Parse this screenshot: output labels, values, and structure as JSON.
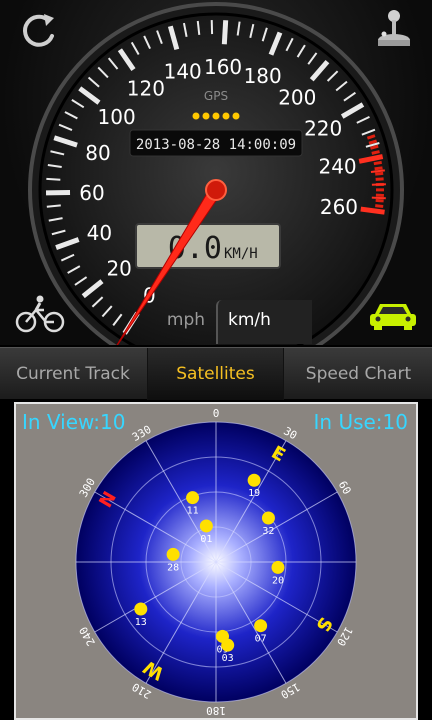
{
  "speedometer": {
    "gps_label": "GPS",
    "datetime": "2013-08-28 14:00:09",
    "speed": "0.0",
    "speed_unit": "KM/H",
    "speed_value": 0,
    "max_speed": 260,
    "gps_signal_dots": 5,
    "ticks": [
      "0",
      "20",
      "40",
      "60",
      "80",
      "100",
      "120",
      "140",
      "160",
      "180",
      "200",
      "220",
      "240",
      "260"
    ]
  },
  "unit_toggle": {
    "mph": "mph",
    "kmh": "km/h",
    "selected": "km/h"
  },
  "icons": {
    "refresh": "refresh-icon",
    "joystick": "joystick-icon",
    "bike": "bicycle-icon",
    "car": "car-icon"
  },
  "tabs": [
    {
      "label": "Current Track",
      "active": false
    },
    {
      "label": "Satellites",
      "active": true
    },
    {
      "label": "Speed Chart",
      "active": false
    }
  ],
  "satellites": {
    "in_view": "In View:10",
    "in_use": "In Use:10",
    "compass": {
      "N": "N",
      "E": "E",
      "S": "S",
      "W": "W"
    },
    "azimuth_labels": [
      "0",
      "30",
      "60",
      "120",
      "150",
      "180",
      "210",
      "240",
      "300",
      "330"
    ],
    "list": [
      {
        "prn": "19",
        "az": 25,
        "el": 32
      },
      {
        "prn": "11",
        "az": 340,
        "el": 46
      },
      {
        "prn": "32",
        "az": 50,
        "el": 46
      },
      {
        "prn": "01",
        "az": 345,
        "el": 66
      },
      {
        "prn": "20",
        "az": 95,
        "el": 50
      },
      {
        "prn": "28",
        "az": 280,
        "el": 62
      },
      {
        "prn": "13",
        "az": 238,
        "el": 33
      },
      {
        "prn": "09",
        "az": 175,
        "el": 42
      },
      {
        "prn": "03",
        "az": 172,
        "el": 36
      },
      {
        "prn": "07",
        "az": 145,
        "el": 40
      }
    ]
  },
  "colors": {
    "accent": "#f6c022",
    "sat_text": "#37d6ff",
    "needle": "#ff2a1a",
    "car": "#c8f000",
    "sat_dot": "#ffe000"
  }
}
